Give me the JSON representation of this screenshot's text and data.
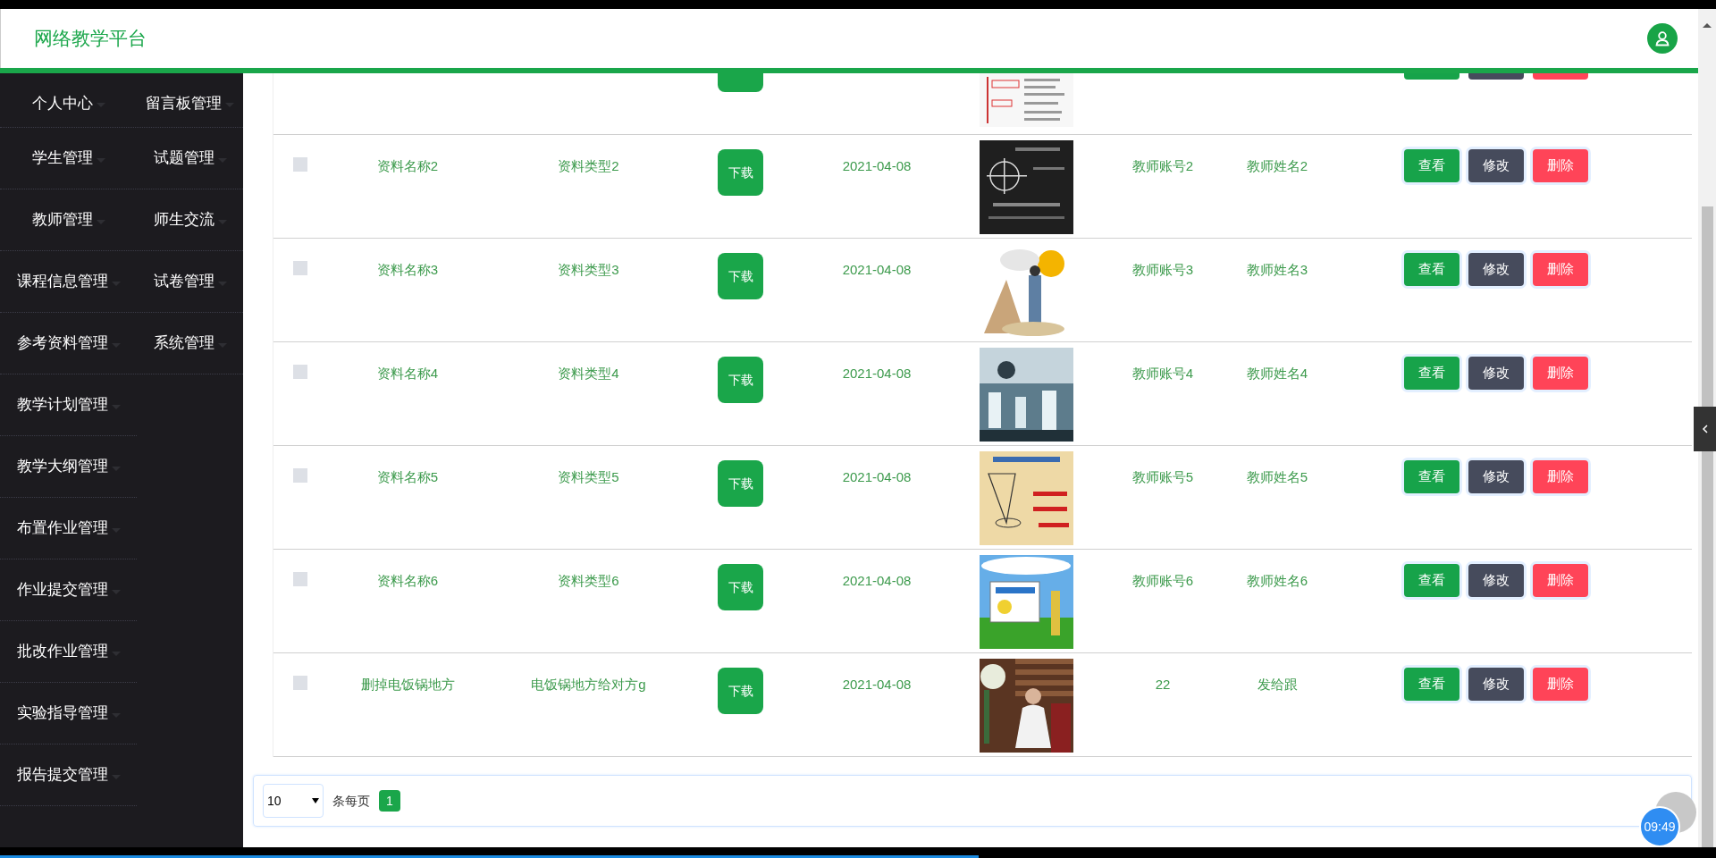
{
  "header": {
    "title": "网络教学平台"
  },
  "sidebar": {
    "rows": [
      {
        "items": [
          {
            "label": "个人中心"
          },
          {
            "label": "留言板管理"
          }
        ]
      },
      {
        "items": [
          {
            "label": "学生管理"
          },
          {
            "label": "试题管理"
          }
        ]
      },
      {
        "items": [
          {
            "label": "教师管理"
          },
          {
            "label": "师生交流"
          }
        ]
      },
      {
        "items": [
          {
            "label": "课程信息管理"
          },
          {
            "label": "试卷管理"
          }
        ]
      },
      {
        "items": [
          {
            "label": "参考资料管理"
          },
          {
            "label": "系统管理"
          }
        ]
      },
      {
        "items": [
          {
            "label": "教学计划管理"
          }
        ]
      },
      {
        "items": [
          {
            "label": "教学大纲管理"
          }
        ]
      },
      {
        "items": [
          {
            "label": "布置作业管理"
          }
        ]
      },
      {
        "items": [
          {
            "label": "作业提交管理"
          }
        ]
      },
      {
        "items": [
          {
            "label": "批改作业管理"
          }
        ]
      },
      {
        "items": [
          {
            "label": "实验指导管理"
          }
        ]
      },
      {
        "items": [
          {
            "label": "报告提交管理"
          }
        ]
      }
    ]
  },
  "table": {
    "rows": [
      {
        "kind": "cut"
      },
      {
        "kind": "full",
        "checked": false,
        "name": "资料名称2",
        "type": "资料类型2",
        "download": "下载",
        "date": "2021-04-08",
        "account": "教师账号2",
        "teacher": "教师姓名2",
        "actions": [
          "查看",
          "修改",
          "删除"
        ]
      },
      {
        "kind": "full",
        "checked": false,
        "name": "资料名称3",
        "type": "资料类型3",
        "download": "下载",
        "date": "2021-04-08",
        "account": "教师账号3",
        "teacher": "教师姓名3",
        "actions": [
          "查看",
          "修改",
          "删除"
        ]
      },
      {
        "kind": "full",
        "checked": false,
        "name": "资料名称4",
        "type": "资料类型4",
        "download": "下载",
        "date": "2021-04-08",
        "account": "教师账号4",
        "teacher": "教师姓名4",
        "actions": [
          "查看",
          "修改",
          "删除"
        ]
      },
      {
        "kind": "full",
        "checked": false,
        "name": "资料名称5",
        "type": "资料类型5",
        "download": "下载",
        "date": "2021-04-08",
        "account": "教师账号5",
        "teacher": "教师姓名5",
        "actions": [
          "查看",
          "修改",
          "删除"
        ]
      },
      {
        "kind": "full",
        "checked": false,
        "name": "资料名称6",
        "type": "资料类型6",
        "download": "下载",
        "date": "2021-04-08",
        "account": "教师账号6",
        "teacher": "教师姓名6",
        "actions": [
          "查看",
          "修改",
          "删除"
        ]
      },
      {
        "kind": "full",
        "checked": false,
        "name": "删掉电饭锅地方",
        "type": "电饭锅地方给对方g",
        "download": "下载",
        "date": "2021-04-08",
        "account": "22",
        "teacher": "发给跟",
        "actions": [
          "查看",
          "修改",
          "删除"
        ]
      }
    ]
  },
  "pagination": {
    "page_size": "10",
    "per_page_label": "条每页",
    "pages": [
      {
        "label": "1",
        "selected": true
      }
    ]
  },
  "clock": "09:49"
}
